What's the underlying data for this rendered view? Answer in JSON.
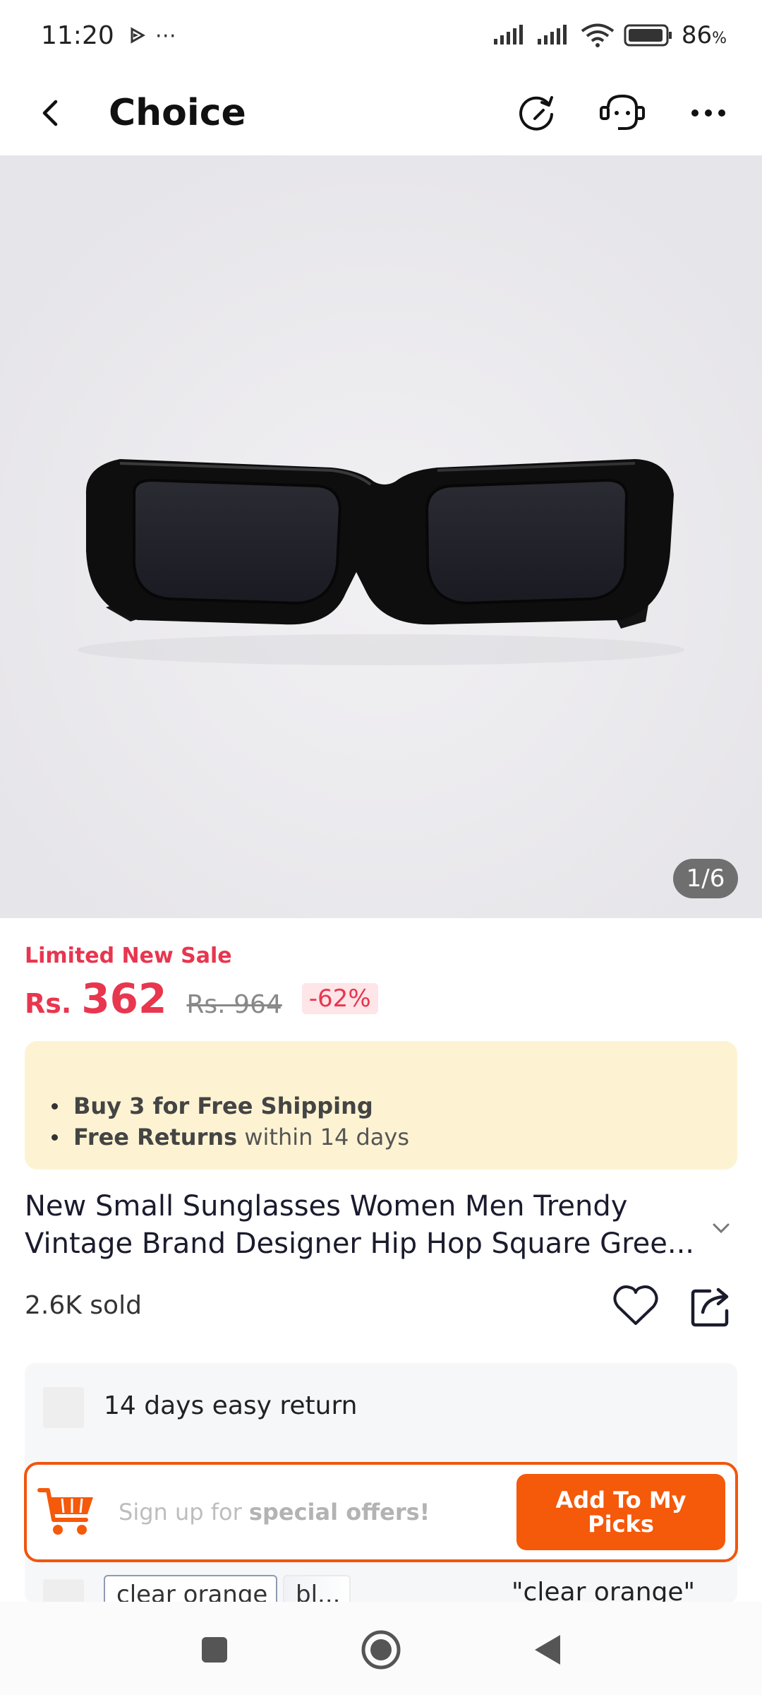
{
  "status_bar": {
    "time": "11:20",
    "extra": "⋯",
    "battery": "86"
  },
  "header": {
    "title": "Choice"
  },
  "gallery": {
    "counter": "1/6"
  },
  "price": {
    "sale_label": "Limited New Sale",
    "currency": "Rs.",
    "current": "362",
    "original": "Rs. 964",
    "discount": "-62%"
  },
  "choice_box": {
    "line1_bold": "Buy 3 for  Free Shipping",
    "line2_bold": "Free Returns",
    "line2_rest": " within 14 days"
  },
  "product": {
    "title": "New Small Sunglasses Women Men Trendy Vintage Brand Designer Hip Hop Square Gree...",
    "sold": "2.6K sold"
  },
  "service": {
    "return_policy": "14 days easy return",
    "variant_chip_1": "clear orange",
    "variant_chip_2": "bl...",
    "selected_variant": "\"clear orange\""
  },
  "signup": {
    "text_prefix": "Sign up for ",
    "text_bold": "special offers!",
    "button": "Add To My Picks"
  },
  "colors": {
    "accent_red": "#e8364f",
    "accent_orange": "#f5590a",
    "choice_bg": "#fdf3d3"
  }
}
